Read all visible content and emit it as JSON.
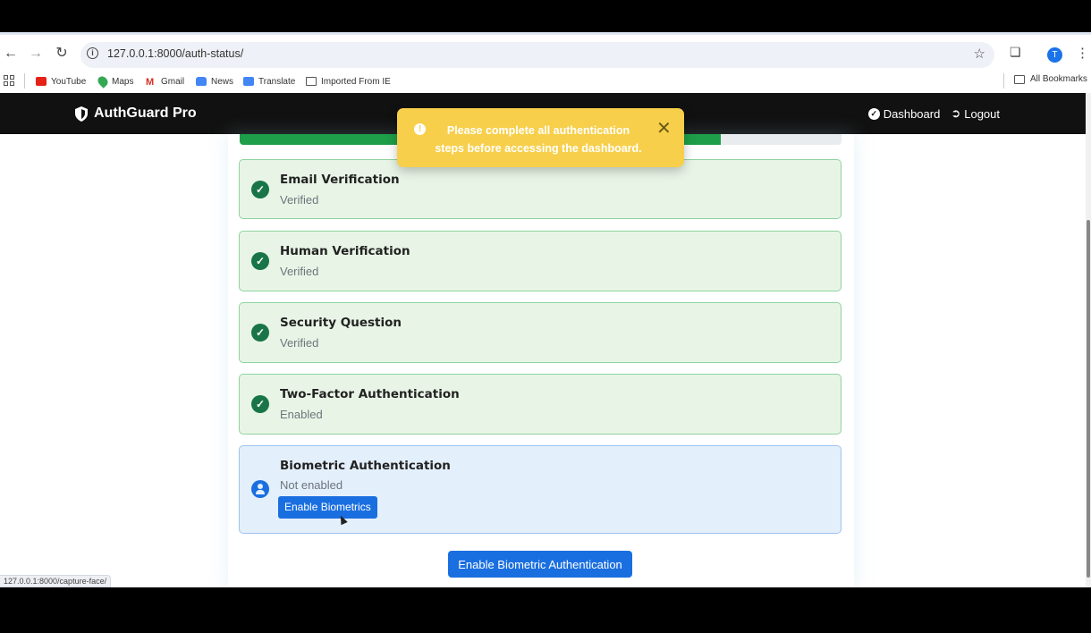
{
  "browser": {
    "url": "127.0.0.1:8000/auth-status/",
    "profile_initial": "T",
    "bookmarks": [
      {
        "label": "YouTube",
        "icon": "youtube-icon"
      },
      {
        "label": "Maps",
        "icon": "maps-icon"
      },
      {
        "label": "Gmail",
        "icon": "gmail-icon"
      },
      {
        "label": "News",
        "icon": "news-icon"
      },
      {
        "label": "Translate",
        "icon": "translate-icon"
      },
      {
        "label": "Imported From IE",
        "icon": "folder-icon"
      }
    ],
    "all_bookmarks": "All Bookmarks",
    "status_url": "127.0.0.1:8000/capture-face/"
  },
  "navbar": {
    "brand": "AuthGuard Pro",
    "links": [
      {
        "label": "Dashboard",
        "icon": "dashboard-icon"
      },
      {
        "label": "Logout",
        "icon": "logout-icon"
      }
    ]
  },
  "progress": {
    "fraction": 0.8,
    "color": "#1e9e49"
  },
  "steps": [
    {
      "title": "Email Verification",
      "status": "Verified",
      "state": "done"
    },
    {
      "title": "Human Verification",
      "status": "Verified",
      "state": "done"
    },
    {
      "title": "Security Question",
      "status": "Verified",
      "state": "done"
    },
    {
      "title": "Two-Factor Authentication",
      "status": "Enabled",
      "state": "done"
    },
    {
      "title": "Biometric Authentication",
      "status": "Not enabled",
      "state": "pending",
      "action": "Enable Biometrics"
    }
  ],
  "main_button": "Enable Biometric Authentication",
  "toast": {
    "message": "Please complete all authentication steps before accessing the dashboard.",
    "color": "#f7cf4a"
  },
  "colors": {
    "primary": "#1a6fe0",
    "success": "#197548",
    "navbar": "#111111"
  }
}
